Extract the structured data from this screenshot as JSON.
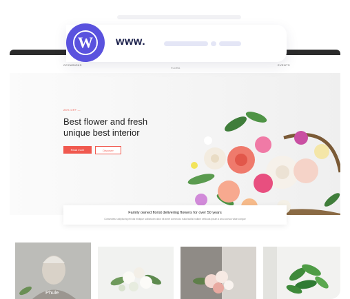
{
  "browser": {
    "www_label": "www.",
    "logo_icon": "wordpress-logo-icon",
    "accent": "#5a52de"
  },
  "site": {
    "nav_left": "OCCASIONS",
    "nav_center": "FLORA",
    "nav_right": "EVENTS",
    "hero_tag": "25% OFF",
    "hero_headline_line1": "Best flower and fresh",
    "hero_headline_line2": "unique best interior",
    "primary_button": "Read more",
    "secondary_button": "Discover",
    "accent": "#f0594f"
  },
  "card": {
    "title": "Family owned florist delivering flowers for over 50 years",
    "text": "Consectetur adipiscing elit dui tristique sollicitudin dolor sit amet commodo nulla facilisi nullam vehicula ipsum a arcu cursus vitae congue"
  },
  "thumbnails": {
    "first_caption": "Phule"
  }
}
